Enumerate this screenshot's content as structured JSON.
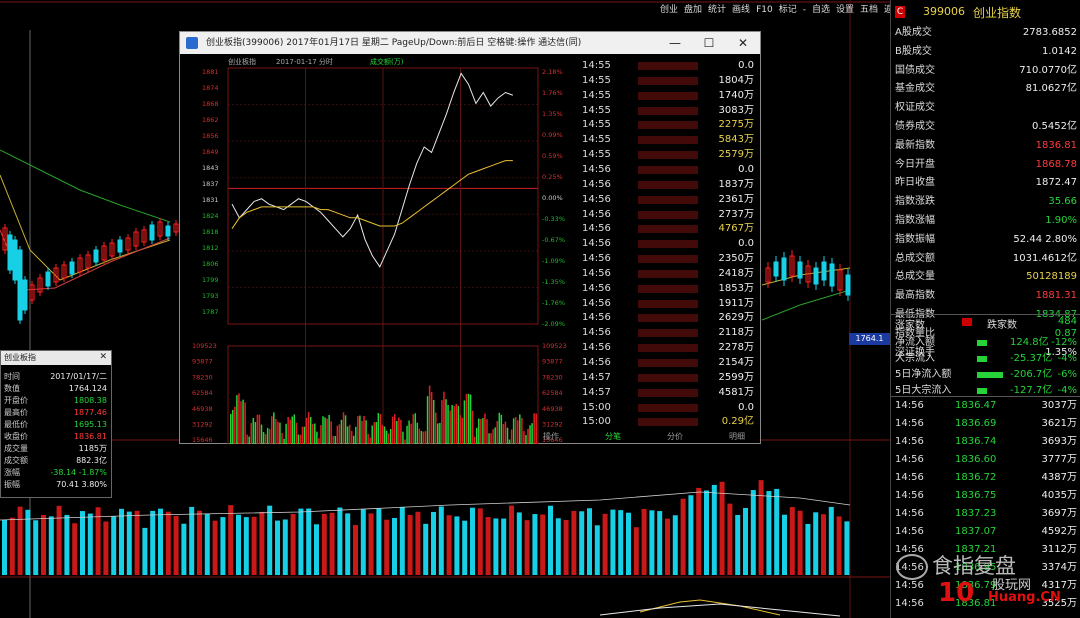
{
  "top_menu": [
    "创业",
    "盘加",
    "统计",
    "画线",
    "F10",
    "标记",
    "-",
    "自选",
    "设置",
    "五档",
    "返回"
  ],
  "right_panel": {
    "code_badge": "C",
    "index_code": "399006",
    "index_name": "创业指数",
    "rows": [
      {
        "label": "A股成交",
        "value": "2783.6852",
        "color": "wht"
      },
      {
        "label": "B股成交",
        "value": "1.0142",
        "color": "wht"
      },
      {
        "label": "国债成交",
        "value": "710.0770亿",
        "color": "wht"
      },
      {
        "label": "基金成交",
        "value": "81.0627亿",
        "color": "wht"
      },
      {
        "label": "权证成交",
        "value": "",
        "color": "wht"
      },
      {
        "label": "债券成交",
        "value": "0.5452亿",
        "color": "wht"
      },
      {
        "label": "最新指数",
        "value": "1836.81",
        "color": "red"
      },
      {
        "label": "今日开盘",
        "value": "1868.78",
        "color": "red"
      },
      {
        "label": "昨日收盘",
        "value": "1872.47",
        "color": "wht"
      },
      {
        "label": "指数涨跌",
        "value": "35.66",
        "color": "grn"
      },
      {
        "label": "指数涨幅",
        "value": "1.90%",
        "color": "grn"
      },
      {
        "label": "指数振幅",
        "value": "52.44 2.80%",
        "color": "wht"
      },
      {
        "label": "总成交额",
        "value": "1031.4612亿",
        "color": "wht"
      },
      {
        "label": "总成交量",
        "value": "50128189",
        "color": "yel"
      },
      {
        "label": "最高指数",
        "value": "1881.31",
        "color": "red"
      },
      {
        "label": "最低指数",
        "value": "1834.87",
        "color": "grn"
      },
      {
        "label": "指数量比",
        "value": "0.87",
        "color": "grn"
      },
      {
        "label": "深证换手",
        "value": "1.35%",
        "color": "wht"
      }
    ],
    "updown": {
      "up_label": "涨家数",
      "up_val": "96",
      "down_label": "跌家数",
      "down_val": "484"
    },
    "flows": [
      {
        "label": "净流入额",
        "v1": "124.8亿",
        "v2": "-12%"
      },
      {
        "label": "大宗流入",
        "v1": "-25.37亿",
        "v2": "-4%"
      },
      {
        "label": "5日净流入额",
        "v1": "-206.7亿",
        "v2": "-6%"
      },
      {
        "label": "5日大宗流入",
        "v1": "-127.7亿",
        "v2": "-4%"
      }
    ],
    "ticks": [
      {
        "t": "14:56",
        "p": "1836.47",
        "v": "3037万"
      },
      {
        "t": "14:56",
        "p": "1836.69",
        "v": "3621万"
      },
      {
        "t": "14:56",
        "p": "1836.74",
        "v": "3693万"
      },
      {
        "t": "14:56",
        "p": "1836.60",
        "v": "3777万"
      },
      {
        "t": "14:56",
        "p": "1836.72",
        "v": "4387万"
      },
      {
        "t": "14:56",
        "p": "1836.75",
        "v": "4035万"
      },
      {
        "t": "14:56",
        "p": "1837.23",
        "v": "3697万"
      },
      {
        "t": "14:56",
        "p": "1837.07",
        "v": "4592万"
      },
      {
        "t": "14:56",
        "p": "1837.21",
        "v": "3112万"
      },
      {
        "t": "14:56",
        "p": "1836.95",
        "v": "3374万"
      },
      {
        "t": "14:56",
        "p": "1836.79",
        "v": "4317万"
      },
      {
        "t": "14:56",
        "p": "1836.81",
        "v": "3525万"
      }
    ]
  },
  "popup": {
    "title": "创业板指(399006) 2017年01月17日 星期二 PageUp/Down:前后日 空格键:操作 通达信(同)",
    "chart_header": [
      "创业板指",
      "2017-01-17 分时",
      "成交额(万)"
    ],
    "minimize": "—",
    "maximize": "☐",
    "close": "✕",
    "left_axis": [
      "1881",
      "1874",
      "1868",
      "1862",
      "1856",
      "1849",
      "1843",
      "1837",
      "1831",
      "1824",
      "1818",
      "1812",
      "1806",
      "1799",
      "1793",
      "1787"
    ],
    "right_axis": [
      "2.18%",
      "1.76%",
      "1.35%",
      "0.99%",
      "0.59%",
      "0.25%",
      "0.00%",
      "-0.33%",
      "-0.67%",
      "-1.09%",
      "-1.35%",
      "-1.76%",
      "-2.09%"
    ],
    "vol_left": [
      "109523",
      "93877",
      "78230",
      "62584",
      "46938",
      "31292",
      "15646"
    ],
    "vol_right": [
      "109523",
      "93877",
      "78230",
      "62584",
      "46938",
      "31292",
      "15646"
    ],
    "ticks": [
      {
        "t": "14:55",
        "v": "0.0",
        "c": "wht"
      },
      {
        "t": "14:55",
        "v": "1804万",
        "c": "wht"
      },
      {
        "t": "14:55",
        "v": "1740万",
        "c": "wht"
      },
      {
        "t": "14:55",
        "v": "3083万",
        "c": "wht"
      },
      {
        "t": "14:55",
        "v": "2275万",
        "c": "yel"
      },
      {
        "t": "14:55",
        "v": "5843万",
        "c": "yel"
      },
      {
        "t": "14:55",
        "v": "2579万",
        "c": "yel"
      },
      {
        "t": "14:56",
        "v": "0.0",
        "c": "wht"
      },
      {
        "t": "14:56",
        "v": "1837万",
        "c": "wht"
      },
      {
        "t": "14:56",
        "v": "2361万",
        "c": "wht"
      },
      {
        "t": "14:56",
        "v": "2737万",
        "c": "wht"
      },
      {
        "t": "14:56",
        "v": "4767万",
        "c": "yel"
      },
      {
        "t": "14:56",
        "v": "0.0",
        "c": "wht"
      },
      {
        "t": "14:56",
        "v": "2350万",
        "c": "wht"
      },
      {
        "t": "14:56",
        "v": "2418万",
        "c": "wht"
      },
      {
        "t": "14:56",
        "v": "1853万",
        "c": "wht"
      },
      {
        "t": "14:56",
        "v": "1911万",
        "c": "wht"
      },
      {
        "t": "14:56",
        "v": "2629万",
        "c": "wht"
      },
      {
        "t": "14:56",
        "v": "2118万",
        "c": "wht"
      },
      {
        "t": "14:56",
        "v": "2278万",
        "c": "wht"
      },
      {
        "t": "14:56",
        "v": "2154万",
        "c": "wht"
      },
      {
        "t": "14:57",
        "v": "2599万",
        "c": "wht"
      },
      {
        "t": "14:57",
        "v": "4581万",
        "c": "wht"
      },
      {
        "t": "15:00",
        "v": "0.0",
        "c": "wht"
      },
      {
        "t": "15:00",
        "v": "0.29亿",
        "c": "yel"
      }
    ],
    "tabs": [
      "操作",
      "分笔",
      "分价",
      "明细"
    ],
    "price_trace": [
      1831,
      1826,
      1829,
      1832,
      1833,
      1831,
      1830,
      1829,
      1831,
      1833,
      1832,
      1830,
      1828,
      1825,
      1822,
      1819,
      1822,
      1827,
      1818,
      1812,
      1808,
      1814,
      1820,
      1829,
      1838,
      1846,
      1852,
      1850,
      1857,
      1864,
      1872,
      1879,
      1875,
      1868,
      1872,
      1867,
      1870,
      1872,
      1871
    ],
    "avg_trace": [
      1822,
      1826,
      1828,
      1829,
      1830,
      1830,
      1830,
      1830,
      1830,
      1830,
      1830,
      1830,
      1829,
      1829,
      1828,
      1827,
      1826,
      1826,
      1825,
      1824,
      1823,
      1823,
      1823,
      1824,
      1826,
      1828,
      1830,
      1832,
      1834,
      1836,
      1838,
      1840,
      1842,
      1843,
      1844,
      1845,
      1846,
      1847,
      1847
    ],
    "price_range": [
      1787,
      1881
    ]
  },
  "infobox": {
    "title": "创业板指",
    "rows": [
      {
        "l": "时间",
        "r": "2017/01/17/二",
        "c": "wht"
      },
      {
        "l": "数值",
        "r": "1764.124",
        "c": "wht"
      },
      {
        "l": "开盘价",
        "r": "1808.38",
        "c": "grn"
      },
      {
        "l": "最高价",
        "r": "1877.46",
        "c": "red"
      },
      {
        "l": "最低价",
        "r": "1695.13",
        "c": "grn"
      },
      {
        "l": "收盘价",
        "r": "1836.81",
        "c": "red"
      },
      {
        "l": "成交量",
        "r": "1185万",
        "c": "wht"
      },
      {
        "l": "成交额",
        "r": "882.3亿",
        "c": "wht"
      },
      {
        "l": "涨幅",
        "r": "-38.14 -1.87%",
        "c": "grn"
      },
      {
        "l": "振幅",
        "r": "70.41 3.80%",
        "c": "wht"
      }
    ]
  },
  "side_label": "1764.1",
  "watermark": {
    "main": "食指复盘",
    "logo": "10",
    "lbl": "股玩网",
    "site": "Huang.CN"
  },
  "colors": {
    "up": "#ff2020",
    "down": "#18d0e6",
    "green": "#26d43a",
    "red": "#ff3b3b"
  }
}
